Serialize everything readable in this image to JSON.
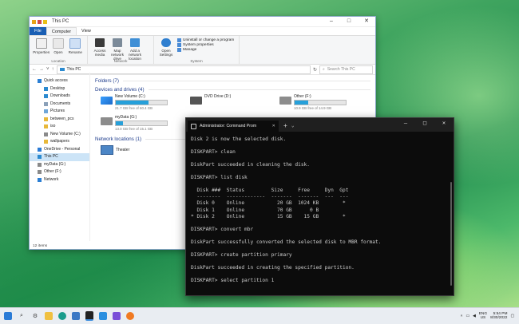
{
  "explorer": {
    "title": "This PC",
    "tabs": [
      "File",
      "Computer",
      "View"
    ],
    "ribbon": {
      "location": {
        "label": "Location",
        "buttons": [
          "Properties",
          "Open",
          "Rename"
        ]
      },
      "network": {
        "label": "Network",
        "buttons": [
          "Access media",
          "Map network drive",
          "Add a network location"
        ]
      },
      "system": {
        "label": "System",
        "open_settings": "Open Settings",
        "items": [
          "Uninstall or change a program",
          "System properties",
          "Manage"
        ]
      }
    },
    "address": {
      "path": "This PC",
      "search_placeholder": "Search This PC"
    },
    "nav": [
      {
        "label": "Quick access",
        "level": 0,
        "icon": "star-icon"
      },
      {
        "label": "Desktop",
        "level": 1,
        "icon": "desktop-icon"
      },
      {
        "label": "Downloads",
        "level": 1,
        "icon": "download-icon"
      },
      {
        "label": "Documents",
        "level": 1,
        "icon": "document-icon"
      },
      {
        "label": "Pictures",
        "level": 1,
        "icon": "picture-icon"
      },
      {
        "label": "between_pcs",
        "level": 1,
        "icon": "folder-icon"
      },
      {
        "label": "iso",
        "level": 1,
        "icon": "folder-icon"
      },
      {
        "label": "New Volume (C:)",
        "level": 1,
        "icon": "drive-icon"
      },
      {
        "label": "wallpapers",
        "level": 1,
        "icon": "folder-icon"
      },
      {
        "label": "OneDrive - Personal",
        "level": 0,
        "icon": "cloud-icon"
      },
      {
        "label": "This PC",
        "level": 0,
        "icon": "pc-icon",
        "selected": true
      },
      {
        "label": "myData (G:)",
        "level": 0,
        "icon": "drive-icon"
      },
      {
        "label": "Other (F:)",
        "level": 0,
        "icon": "drive-icon"
      },
      {
        "label": "Network",
        "level": 0,
        "icon": "network-icon"
      }
    ],
    "sections": {
      "folders": "Folders (7)",
      "devices": "Devices and drives (4)",
      "network": "Network locations (1)"
    },
    "drives": [
      {
        "name": "New Volume (C:)",
        "info": "21.7 GB free of 60.4 GB",
        "used": 0.64,
        "icon": "windows-drive-icon"
      },
      {
        "name": "DVD Drive (D:)",
        "info": "",
        "used": null,
        "icon": "dvd-drive-icon"
      },
      {
        "name": "Other (F:)",
        "info": "10.9 GB free of 14.9 GB",
        "used": 0.27,
        "icon": "drive-icon"
      },
      {
        "name": "myData (G:)",
        "info": "13.0 GB free of 15.1 GB",
        "used": 0.14,
        "icon": "drive-icon"
      }
    ],
    "network_locations": [
      {
        "name": "Theater",
        "icon": "media-device-icon"
      }
    ],
    "status": "12 items"
  },
  "terminal": {
    "tab_title": "Administrator: Command Prom",
    "lines": [
      "Disk 2 is now the selected disk.",
      "",
      "DISKPART> clean",
      "",
      "DiskPart succeeded in cleaning the disk.",
      "",
      "DISKPART> list disk",
      "",
      "  Disk ###  Status         Size     Free     Dyn  Gpt",
      "  --------  -------------  -------  -------  ---  ---",
      "  Disk 0    Online           20 GB  1024 KB        *",
      "  Disk 1    Online           70 GB      0 B",
      "* Disk 2    Online           15 GB    15 GB        *",
      "",
      "DISKPART> convert mbr",
      "",
      "DiskPart successfully converted the selected disk to MBR format.",
      "",
      "DISKPART> create partition primary",
      "",
      "DiskPart succeeded in creating the specified partition.",
      "",
      "DISKPART> select partition 1"
    ]
  },
  "taskbar": {
    "icons": [
      "windows-start-icon",
      "search-icon",
      "settings-icon",
      "file-explorer-icon",
      "edge-icon",
      "store-icon",
      "terminal-icon",
      "vscode-icon",
      "app-icon",
      "firefox-icon"
    ],
    "lang": [
      "ENG",
      "US"
    ],
    "time": "5:54 PM",
    "date": "8/30/2022"
  }
}
